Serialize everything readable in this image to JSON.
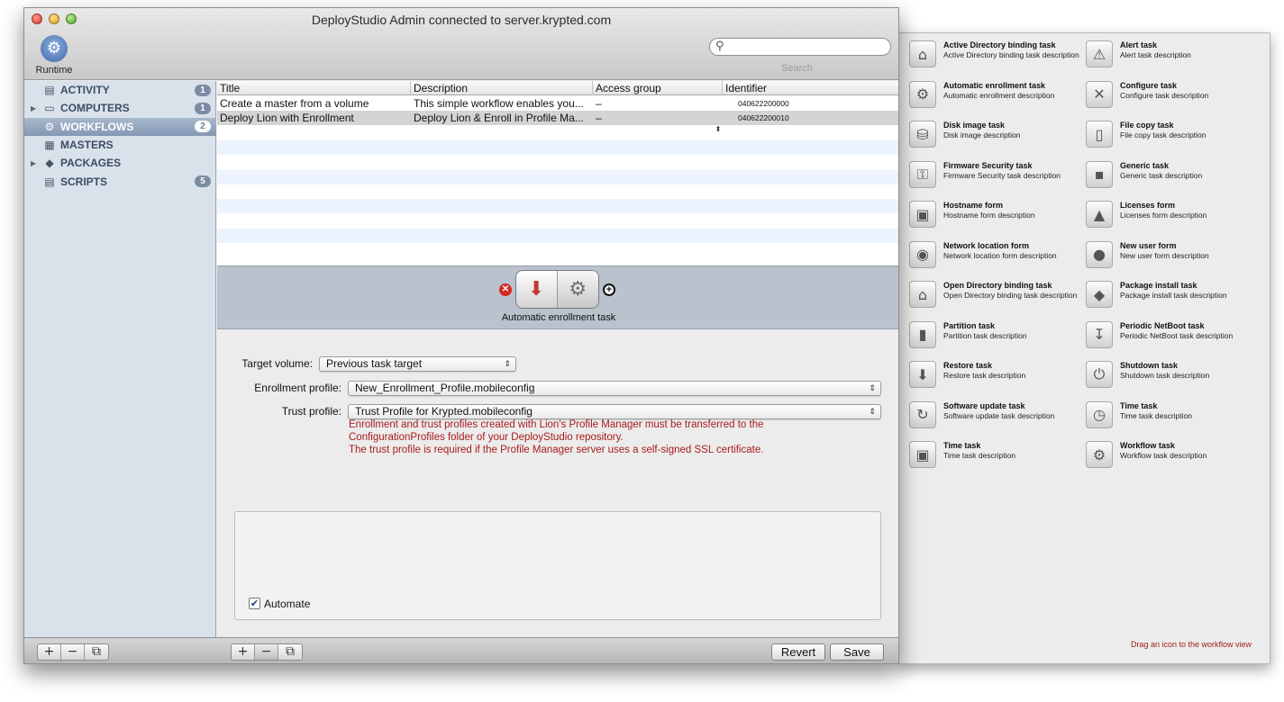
{
  "window": {
    "title": "DeployStudio Admin connected to server.krypted.com",
    "runtime_label": "Runtime",
    "search_label": "Search",
    "search_value": ""
  },
  "sidebar": {
    "items": [
      {
        "label": "ACTIVITY",
        "badge": "1",
        "expandable": false,
        "selected": false,
        "icon": "activity-monitor-icon"
      },
      {
        "label": "COMPUTERS",
        "badge": "1",
        "expandable": true,
        "selected": false,
        "icon": "computer-icon"
      },
      {
        "label": "WORKFLOWS",
        "badge": "2",
        "expandable": false,
        "selected": true,
        "icon": "gear-icon"
      },
      {
        "label": "MASTERS",
        "badge": "",
        "expandable": false,
        "selected": false,
        "icon": "disk-icon"
      },
      {
        "label": "PACKAGES",
        "badge": "",
        "expandable": true,
        "selected": false,
        "icon": "package-icon"
      },
      {
        "label": "SCRIPTS",
        "badge": "5",
        "expandable": false,
        "selected": false,
        "icon": "script-icon"
      }
    ]
  },
  "table": {
    "columns": [
      "Title",
      "Description",
      "Access group",
      "Identifier"
    ],
    "rows": [
      {
        "title": "Create a master from a volume",
        "description": "This simple workflow enables you...",
        "access": "–",
        "identifier": "040622200000"
      },
      {
        "title": "Deploy Lion with Enrollment",
        "description": "Deploy Lion & Enroll in Profile Ma...",
        "access": "–",
        "identifier": "040622200010"
      }
    ]
  },
  "workflow": {
    "selected_task_caption": "Automatic enrollment task"
  },
  "form": {
    "target_volume_label": "Target volume:",
    "target_volume_value": "Previous task target",
    "enrollment_profile_label": "Enrollment profile:",
    "enrollment_profile_value": "New_Enrollment_Profile.mobileconfig",
    "trust_profile_label": "Trust profile:",
    "trust_profile_value": "Trust Profile for Krypted.mobileconfig",
    "note_line1": "Enrollment and trust profiles created with Lion's Profile Manager must be transferred to the",
    "note_line2": "ConfigurationProfiles folder of your DeployStudio repository.",
    "note_line3": "The trust profile is required if the Profile Manager server uses a self-signed SSL certificate.",
    "automate_label": "Automate",
    "automate_checked": true
  },
  "bottom": {
    "revert_label": "Revert",
    "save_label": "Save"
  },
  "palette": {
    "hint": "Drag an icon to the workflow view",
    "tasks": [
      {
        "name": "Active Directory binding task",
        "desc": "Active Directory binding task description",
        "icon": "active-directory-icon",
        "glyph": "⌂"
      },
      {
        "name": "Alert task",
        "desc": "Alert task description",
        "icon": "alert-icon",
        "glyph": "⚠"
      },
      {
        "name": "Automatic enrollment task",
        "desc": "Automatic enrollment description",
        "icon": "enrollment-gear-icon",
        "glyph": "⚙"
      },
      {
        "name": "Configure task",
        "desc": "Configure task description",
        "icon": "configure-tools-icon",
        "glyph": "✕"
      },
      {
        "name": "Disk image task",
        "desc": "Disk image description",
        "icon": "disk-image-icon",
        "glyph": "⛁"
      },
      {
        "name": "File copy task",
        "desc": "File copy task description",
        "icon": "file-copy-icon",
        "glyph": "▯"
      },
      {
        "name": "Firmware Security task",
        "desc": "Firmware Security task description",
        "icon": "lock-icon",
        "glyph": "⚿"
      },
      {
        "name": "Generic task",
        "desc": "Generic task description",
        "icon": "terminal-icon",
        "glyph": "▪"
      },
      {
        "name": "Hostname form",
        "desc": "Hostname form description",
        "icon": "hostname-icon",
        "glyph": "▣"
      },
      {
        "name": "Licenses form",
        "desc": "Licenses form description",
        "icon": "licenses-icon",
        "glyph": "▲"
      },
      {
        "name": "Network location form",
        "desc": "Network location form description",
        "icon": "network-globe-icon",
        "glyph": "◉"
      },
      {
        "name": "New user form",
        "desc": "New user form description",
        "icon": "user-icon",
        "glyph": "●"
      },
      {
        "name": "Open Directory binding task",
        "desc": "Open Directory binding task description",
        "icon": "open-directory-icon",
        "glyph": "⌂"
      },
      {
        "name": "Package install task",
        "desc": "Package install task description",
        "icon": "package-icon",
        "glyph": "◆"
      },
      {
        "name": "Partition task",
        "desc": "Partition task description",
        "icon": "partition-drive-icon",
        "glyph": "▮"
      },
      {
        "name": "Periodic NetBoot task",
        "desc": "Periodic NetBoot task description",
        "icon": "netboot-icon",
        "glyph": "↧"
      },
      {
        "name": "Restore task",
        "desc": "Restore task description",
        "icon": "restore-icon",
        "glyph": "⬇"
      },
      {
        "name": "Shutdown task",
        "desc": "Shutdown task description",
        "icon": "shutdown-icon",
        "glyph": "⏻"
      },
      {
        "name": "Software update task",
        "desc": "Software update task description",
        "icon": "software-update-icon",
        "glyph": "↻"
      },
      {
        "name": "Time task",
        "desc": "Time task description",
        "icon": "clock-icon",
        "glyph": "◷"
      },
      {
        "name": "Time task",
        "desc": "Time task description",
        "icon": "time-display-icon",
        "glyph": "▣"
      },
      {
        "name": "Workflow task",
        "desc": "Workflow task description",
        "icon": "workflow-gear-icon",
        "glyph": "⚙"
      }
    ]
  },
  "colors": {
    "note_red": "#a81b1b",
    "sidebar_bg": "#d9e1ea",
    "selection": "#8498b4",
    "close_red": "#d8332a"
  }
}
